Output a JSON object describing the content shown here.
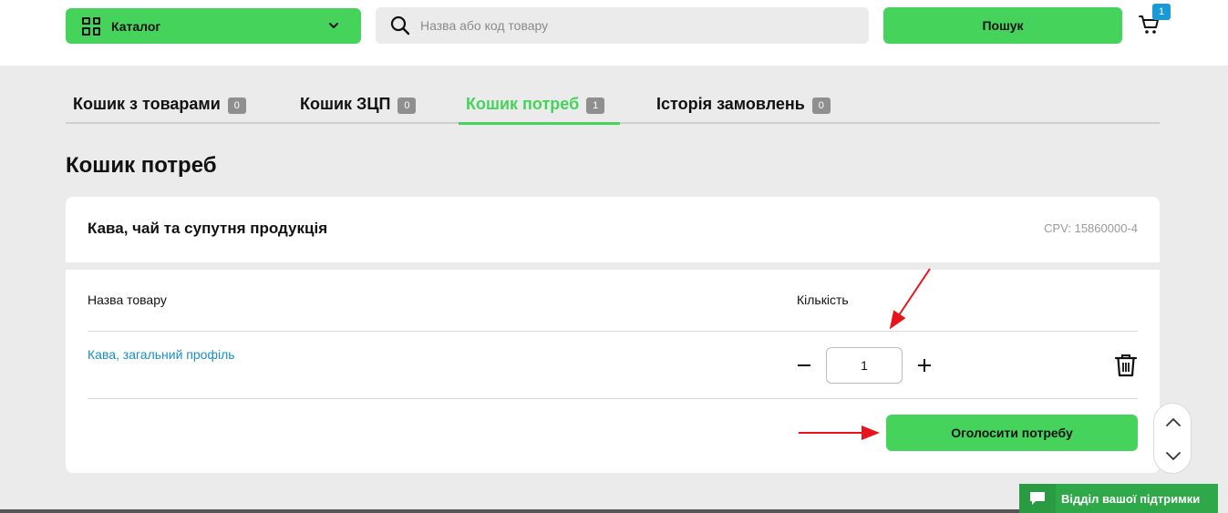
{
  "header": {
    "catalog_label": "Каталог",
    "search_placeholder": "Назва або код товару",
    "search_button": "Пошук",
    "cart_count": "1"
  },
  "tabs": [
    {
      "label": "Кошик з товарами",
      "count": "0"
    },
    {
      "label": "Кошик ЗЦП",
      "count": "0"
    },
    {
      "label": "Кошик потреб",
      "count": "1",
      "active": true
    },
    {
      "label": "Історія замовлень",
      "count": "0"
    }
  ],
  "page_title": "Кошик потреб",
  "category": {
    "title": "Кава, чай та супутня продукція",
    "cpv": "CPV: 15860000-4"
  },
  "table": {
    "col_name": "Назва товару",
    "col_qty": "Кількість",
    "rows": [
      {
        "name": "Кава, загальний профіль",
        "qty": "1"
      }
    ]
  },
  "announce_button": "Оголосити потребу",
  "support_label": "Відділ вашої підтримки",
  "colors": {
    "accent": "#46d35c",
    "link": "#1a8ec7",
    "badge_blue": "#1a9ad6",
    "annotation_arrow": "#e8141b"
  }
}
